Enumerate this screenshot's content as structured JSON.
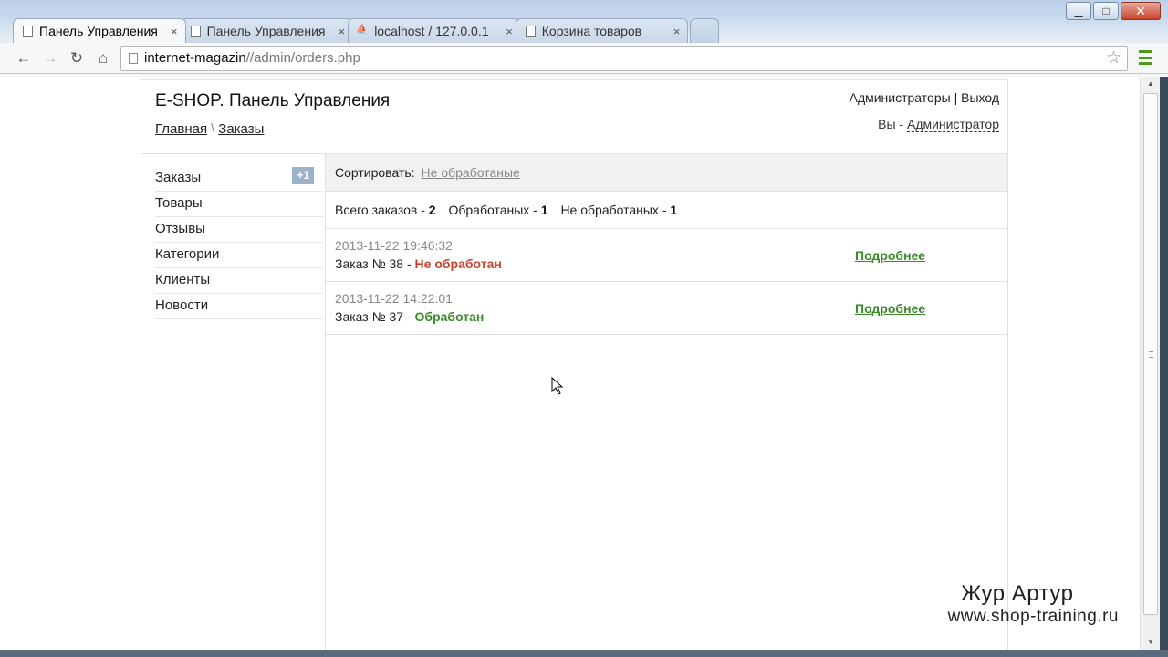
{
  "browser": {
    "tabs": [
      {
        "title": "Панель Управления",
        "icon": "page-icon",
        "active": true
      },
      {
        "title": "Панель Управления",
        "icon": "page-icon",
        "active": false
      },
      {
        "title": "localhost / 127.0.0.1",
        "icon": "phpmyadmin-icon",
        "active": false
      },
      {
        "title": "Корзина товаров",
        "icon": "page-icon",
        "active": false
      }
    ],
    "tab_close_glyph": "×",
    "url_host": "internet-magazin",
    "url_path": "//admin/orders.php",
    "nav": {
      "back": "←",
      "forward": "→",
      "reload": "↻",
      "home": "⌂"
    },
    "star": "☆",
    "window_controls": {
      "minimize": "▁",
      "maximize": "□",
      "close": "✕"
    }
  },
  "header": {
    "site_title": "E-SHOP. Панель Управления",
    "breadcrumb": [
      {
        "label": "Главная"
      },
      {
        "label": "Заказы"
      }
    ],
    "breadcrumb_sep": "\\",
    "top_links": {
      "admins": "Администраторы",
      "sep": " | ",
      "logout": "Выход"
    },
    "user_line": {
      "prefix": "Вы - ",
      "role": "Администратор"
    }
  },
  "sidebar": {
    "items": [
      {
        "label": "Заказы",
        "badge": "+1"
      },
      {
        "label": "Товары"
      },
      {
        "label": "Отзывы"
      },
      {
        "label": "Категории"
      },
      {
        "label": "Клиенты"
      },
      {
        "label": "Новости"
      }
    ]
  },
  "content": {
    "sort_label": "Сортировать:",
    "sort_link": "Не обработаные",
    "stats": {
      "total_label": "Всего заказов - ",
      "total": "2",
      "processed_label": "Обработаных - ",
      "processed": "1",
      "unprocessed_label": "Не обработаных - ",
      "unprocessed": "1"
    },
    "orders": [
      {
        "date": "2013-11-22 19:46:32",
        "title": "Заказ № 38 - ",
        "status": "Не обработан",
        "status_color": "#c0472f",
        "more": "Подробнее"
      },
      {
        "date": "2013-11-22 14:22:01",
        "title": "Заказ № 37 - ",
        "status": "Обработан",
        "status_color": "#3a8a2a",
        "more": "Подробнее"
      }
    ]
  },
  "watermark": {
    "name": "Жур Артур",
    "site": "www.shop-training.ru"
  }
}
